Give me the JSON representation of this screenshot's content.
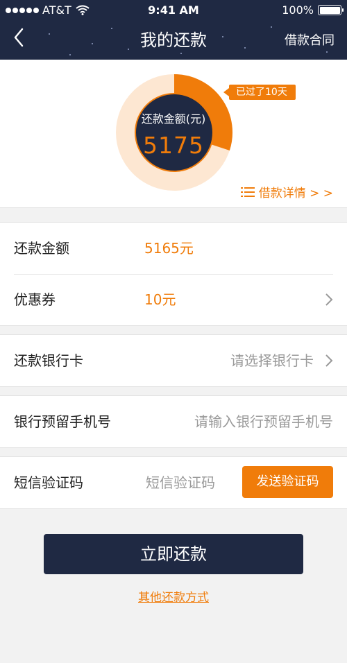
{
  "status_bar": {
    "carrier": "AT&T",
    "time": "9:41 AM",
    "battery": "100%"
  },
  "nav": {
    "title": "我的还款",
    "right_action": "借款合同"
  },
  "summary": {
    "center_label": "还款金额(元)",
    "center_value": "5175",
    "elapsed_tip": "已过了10天",
    "detail_link": "借款详情 > >",
    "progress_fraction": 0.3,
    "colors": {
      "progress": "#f07c0a",
      "track": "#fde7d2",
      "center": "#1f2943"
    }
  },
  "details": {
    "amount_label": "还款金额",
    "amount_value": "5165元",
    "coupon_label": "优惠券",
    "coupon_value": "10元"
  },
  "bank_card": {
    "label": "还款银行卡",
    "hint": "请选择银行卡"
  },
  "phone": {
    "label": "银行预留手机号",
    "placeholder": "请输入银行预留手机号"
  },
  "sms": {
    "label": "短信验证码",
    "placeholder": "短信验证码",
    "send_button": "发送验证码"
  },
  "actions": {
    "primary": "立即还款",
    "other_methods": "其他还款方式"
  },
  "icons": [
    "back-chevron-icon",
    "wifi-icon",
    "battery-icon",
    "list-icon",
    "chevron-right-icon"
  ]
}
